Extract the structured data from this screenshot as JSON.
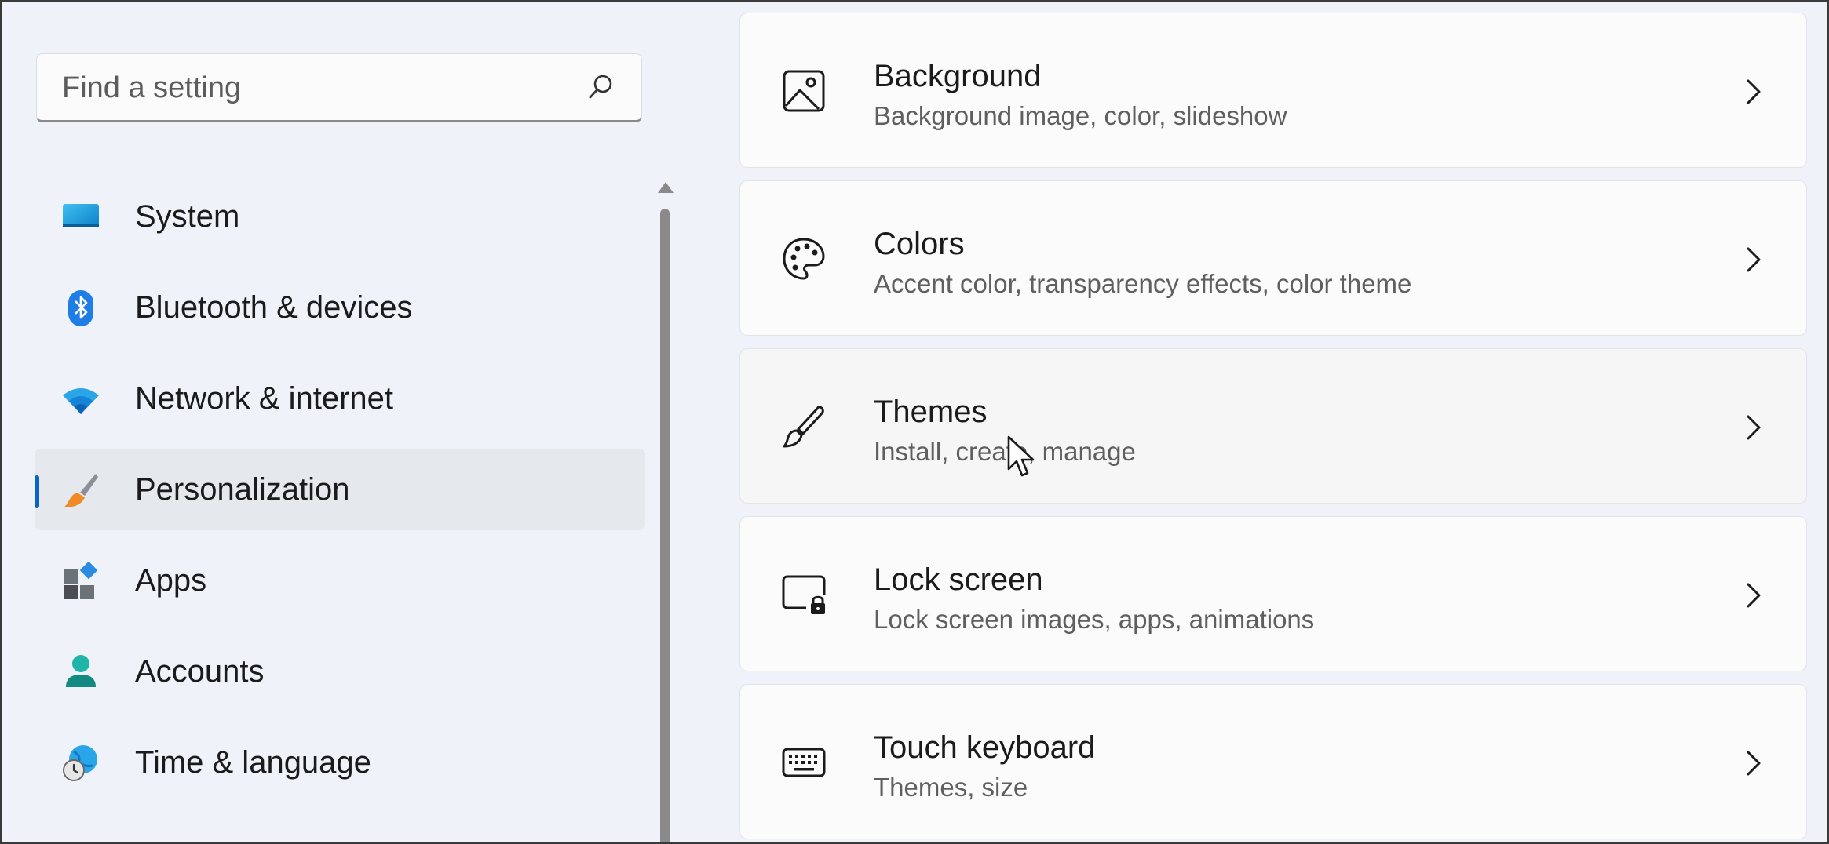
{
  "search": {
    "placeholder": "Find a setting",
    "value": "",
    "icon": "search-icon"
  },
  "sidebar": {
    "selected_index": 3,
    "accent_color": "#0a64c2",
    "items": [
      {
        "label": "System",
        "icon": "monitor-icon"
      },
      {
        "label": "Bluetooth & devices",
        "icon": "bluetooth-icon"
      },
      {
        "label": "Network & internet",
        "icon": "wifi-icon"
      },
      {
        "label": "Personalization",
        "icon": "paintbrush-icon"
      },
      {
        "label": "Apps",
        "icon": "apps-icon"
      },
      {
        "label": "Accounts",
        "icon": "person-icon"
      },
      {
        "label": "Time & language",
        "icon": "globe-clock-icon"
      }
    ]
  },
  "main": {
    "cards": [
      {
        "title": "Background",
        "subtitle": "Background image, color, slideshow",
        "icon": "image-icon"
      },
      {
        "title": "Colors",
        "subtitle": "Accent color, transparency effects, color theme",
        "icon": "palette-icon"
      },
      {
        "title": "Themes",
        "subtitle": "Install, create, manage",
        "icon": "brush-icon"
      },
      {
        "title": "Lock screen",
        "subtitle": "Lock screen images, apps, animations",
        "icon": "lock-screen-icon"
      },
      {
        "title": "Touch keyboard",
        "subtitle": "Themes, size",
        "icon": "keyboard-icon"
      }
    ],
    "hovered_index": 2
  }
}
